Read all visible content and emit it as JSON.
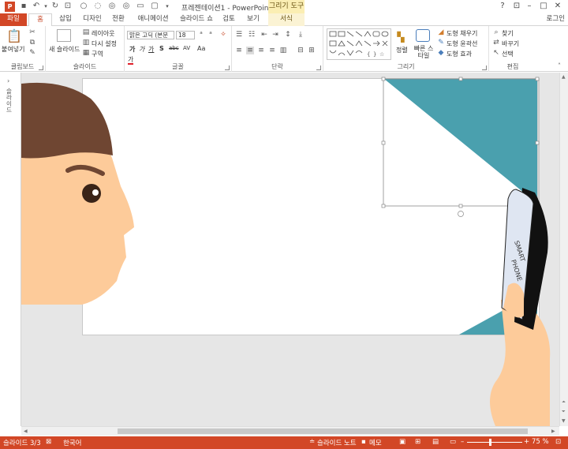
{
  "window": {
    "title": "프레젠테이션1 - PowerPoint",
    "contextual_group": "그리기 도구",
    "sign_in": "로그인"
  },
  "tabs": [
    "파일",
    "홈",
    "삽입",
    "디자인",
    "전환",
    "애니메이션",
    "슬라이드 쇼",
    "검토",
    "보기",
    "서식"
  ],
  "ribbon": {
    "clipboard": {
      "label": "클립보드",
      "paste": "붙여넣기"
    },
    "slides": {
      "label": "슬라이드",
      "new_slide": "새 슬라이드",
      "layout": "레이아웃",
      "reset": "다시 설정",
      "section": "구역"
    },
    "font": {
      "label": "글꼴",
      "font_name": "맑은 고딕 (본문",
      "font_size": "18",
      "bold": "가",
      "italic": "가",
      "underline": "가",
      "shadow": "S",
      "strike": "abc",
      "spacing": "AV",
      "case": "Aa",
      "color": "가"
    },
    "paragraph": {
      "label": "단락"
    },
    "drawing": {
      "label": "그리기",
      "arrange": "정렬",
      "quick_styles": "빠른 스타일",
      "shape_fill": "도형 채우기",
      "shape_outline": "도형 윤곽선",
      "shape_effects": "도형 효과"
    },
    "editing": {
      "label": "편집",
      "find": "찾기",
      "replace": "바꾸기",
      "select": "선택"
    }
  },
  "left_panel": {
    "label": "슬라이드"
  },
  "slide": {
    "phone_text_line1": "SMART",
    "phone_text_line2": "PHONE"
  },
  "status": {
    "slide_num": "슬라이드 3/3",
    "language": "한국어",
    "notes": "슬라이드 노트",
    "comments": "메모",
    "zoom": "75 %"
  },
  "colors": {
    "accent": "#D24726",
    "teal": "#4AA0AE",
    "skin": "#FDCB9A",
    "hair": "#6F4632",
    "eye": "#3A2418"
  }
}
